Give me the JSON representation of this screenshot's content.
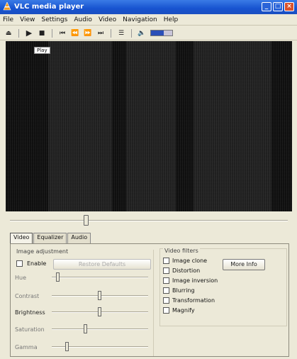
{
  "window": {
    "title": "VLC media player",
    "controls": [
      "_",
      "□",
      "×"
    ]
  },
  "menu": [
    "File",
    "View",
    "Settings",
    "Audio",
    "Video",
    "Navigation",
    "Help"
  ],
  "toolbar": {
    "icons": [
      "eject-icon",
      "play-icon",
      "stop-icon",
      "prev-icon",
      "rewind-icon",
      "forward-icon",
      "next-icon",
      "playlist-icon",
      "speaker-icon"
    ],
    "volume_level": 0.6
  },
  "video": {
    "tag": "Play"
  },
  "seek": {
    "position": 0.27
  },
  "tabs": [
    "Video",
    "Equalizer",
    "Audio"
  ],
  "image_adjustment": {
    "title": "Image adjustment",
    "enable_label": "Enable",
    "restore_label": "Restore Defaults",
    "sliders": [
      {
        "label": "Hue",
        "value": 0.05
      },
      {
        "label": "Contrast",
        "value": 0.5
      },
      {
        "label": "Brightness",
        "value": 0.5
      },
      {
        "label": "Saturation",
        "value": 0.35
      },
      {
        "label": "Gamma",
        "value": 0.15
      }
    ]
  },
  "video_filters": {
    "title": "Video filters",
    "more_info_label": "More Info",
    "items": [
      "Image clone",
      "Distortion",
      "Image inversion",
      "Blurring",
      "Transformation",
      "Magnify"
    ]
  }
}
